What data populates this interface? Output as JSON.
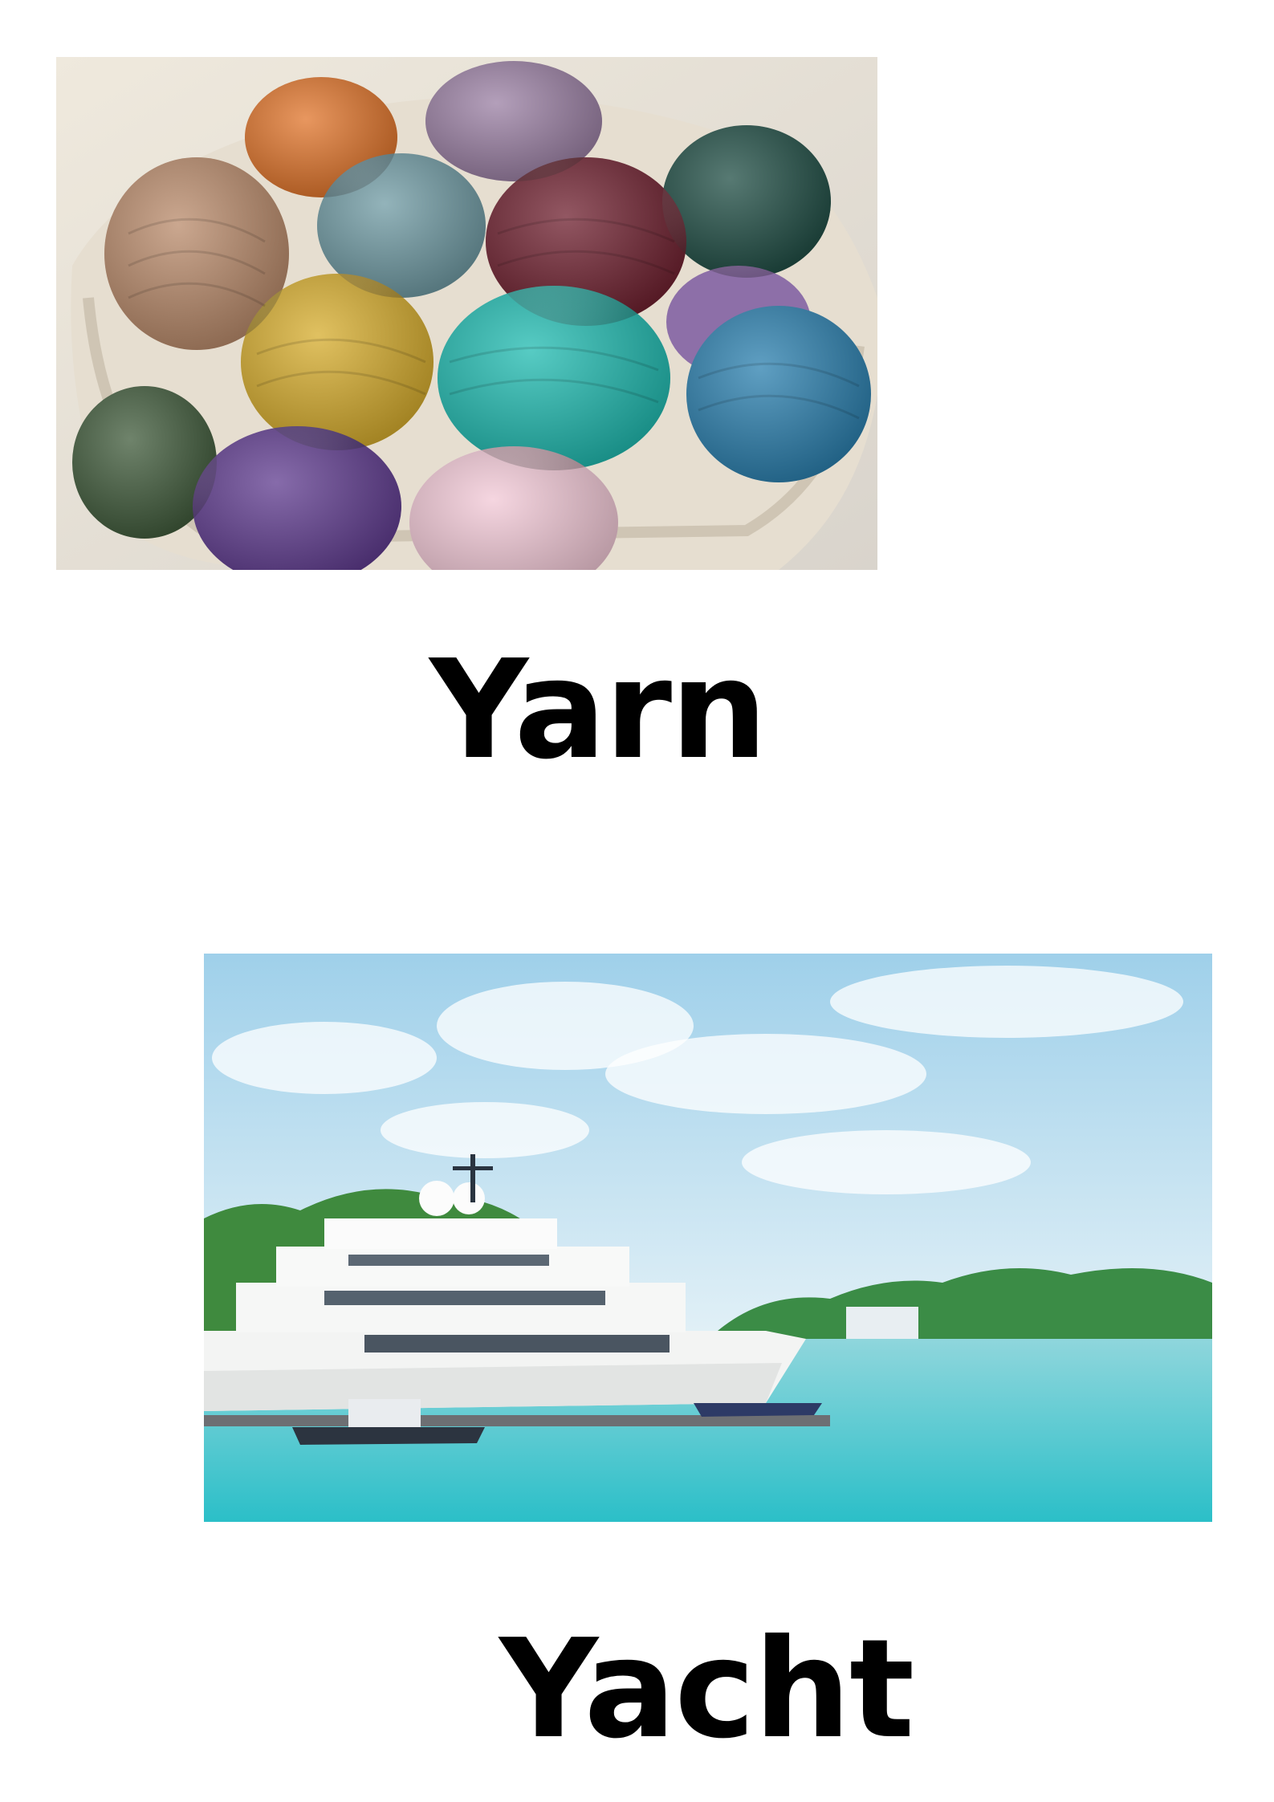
{
  "cards": [
    {
      "word": "Yarn",
      "image_subject": "balls-of-yarn-in-basket"
    },
    {
      "word": "Yacht",
      "image_subject": "yacht-in-marina"
    }
  ],
  "colors": {
    "text": "#000000",
    "background": "#ffffff",
    "yarn_colors": [
      "#b98a6a",
      "#e0742a",
      "#9a7fa3",
      "#1f4d44",
      "#6f9aa3",
      "#6e1f2e",
      "#d6ac2c",
      "#1fbab0",
      "#2a7fae",
      "#3f5a3a",
      "#5e3a8e",
      "#f2c8d6"
    ],
    "sky": "#bfe3f2",
    "water": "#42c3cc"
  }
}
